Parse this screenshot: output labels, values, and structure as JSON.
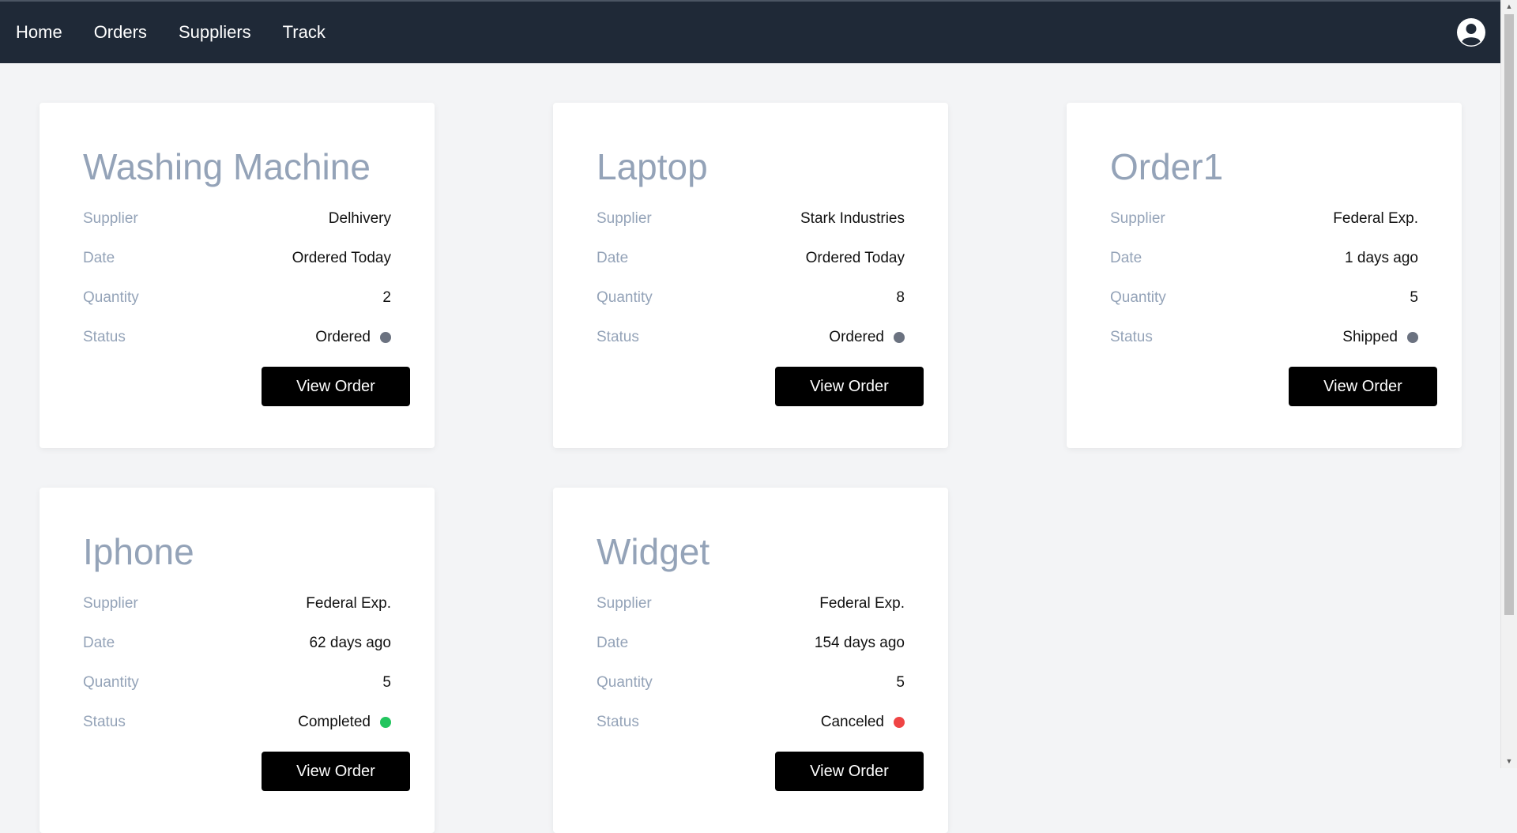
{
  "nav": {
    "links": [
      "Home",
      "Orders",
      "Suppliers",
      "Track"
    ]
  },
  "labels": {
    "supplier": "Supplier",
    "date": "Date",
    "quantity": "Quantity",
    "status": "Status",
    "view_order": "View Order"
  },
  "colors": {
    "navbar": "#1f2937",
    "status_ordered": "#6b7280",
    "status_shipped": "#6b7280",
    "status_completed": "#22c55e",
    "status_canceled": "#ef4444"
  },
  "orders": [
    {
      "title": "Washing Machine",
      "supplier": "Delhivery",
      "date": "Ordered Today",
      "quantity": "2",
      "status": "Ordered",
      "status_color": "#6b7280"
    },
    {
      "title": "Laptop",
      "supplier": "Stark Industries",
      "date": "Ordered Today",
      "quantity": "8",
      "status": "Ordered",
      "status_color": "#6b7280"
    },
    {
      "title": "Order1",
      "supplier": "Federal Exp.",
      "date": "1 days ago",
      "quantity": "5",
      "status": "Shipped",
      "status_color": "#6b7280"
    },
    {
      "title": "Iphone",
      "supplier": "Federal Exp.",
      "date": "62 days ago",
      "quantity": "5",
      "status": "Completed",
      "status_color": "#22c55e"
    },
    {
      "title": "Widget",
      "supplier": "Federal Exp.",
      "date": "154 days ago",
      "quantity": "5",
      "status": "Canceled",
      "status_color": "#ef4444"
    }
  ]
}
